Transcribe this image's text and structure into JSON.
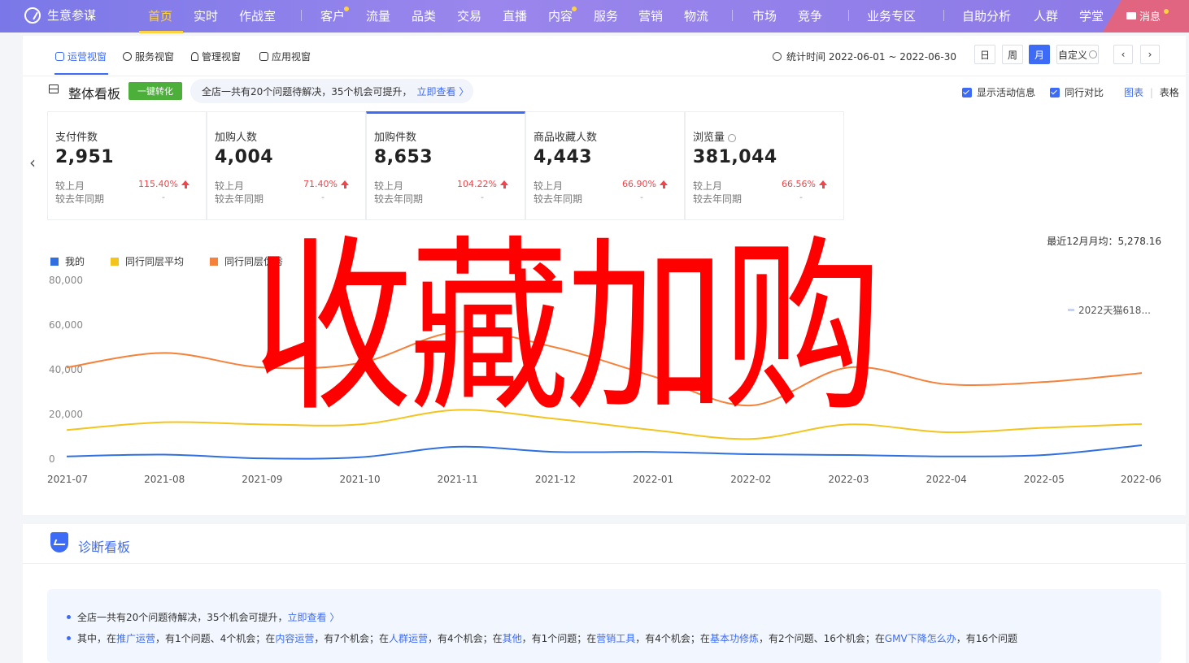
{
  "topnav": {
    "brand": "生意参谋",
    "items": [
      {
        "label": "首页",
        "active": true
      },
      {
        "label": "实时"
      },
      {
        "label": "作战室"
      },
      {
        "label": "客户",
        "dot": true
      },
      {
        "label": "流量"
      },
      {
        "label": "品类"
      },
      {
        "label": "交易"
      },
      {
        "label": "直播"
      },
      {
        "label": "内容",
        "dot": true
      },
      {
        "label": "服务"
      },
      {
        "label": "营销"
      },
      {
        "label": "物流"
      },
      {
        "label": "市场"
      },
      {
        "label": "竞争"
      },
      {
        "label": "业务专区"
      },
      {
        "label": "自助分析"
      },
      {
        "label": "人群"
      },
      {
        "label": "学堂"
      }
    ],
    "message": "消息",
    "accent": "#ffd23f"
  },
  "view_tabs": [
    {
      "label": "运营视窗",
      "icon": "shield-icon",
      "active": true
    },
    {
      "label": "服务视窗",
      "icon": "headset-icon"
    },
    {
      "label": "管理视窗",
      "icon": "bulb-icon"
    },
    {
      "label": "应用视窗",
      "icon": "home-icon"
    }
  ],
  "stat_time": "统计时间 2022-06-01 ~ 2022-06-30",
  "date_buttons": [
    "日",
    "周",
    "月",
    "自定义"
  ],
  "date_active": "月",
  "board": {
    "title": "整体看板",
    "convert_button": "一键转化",
    "issue_text": "全店一共有20个问题待解决，35个机会可提升，",
    "issue_link": "立即查看 〉",
    "show_activity": "显示活动信息",
    "peer_compare": "同行对比",
    "view_chart": "图表",
    "view_sep": "|",
    "view_table": "表格"
  },
  "kpis": [
    {
      "label": "支付件数",
      "value": "2,951",
      "mom_label": "较上月",
      "mom": "115.40%",
      "yoy_label": "较去年同期",
      "yoy": "-"
    },
    {
      "label": "加购人数",
      "value": "4,004",
      "mom_label": "较上月",
      "mom": "71.40%",
      "yoy_label": "较去年同期",
      "yoy": "-"
    },
    {
      "label": "加购件数",
      "value": "8,653",
      "mom_label": "较上月",
      "mom": "104.22%",
      "yoy_label": "较去年同期",
      "yoy": "-",
      "active": true
    },
    {
      "label": "商品收藏人数",
      "value": "4,443",
      "mom_label": "较上月",
      "mom": "66.90%",
      "yoy_label": "较去年同期",
      "yoy": "-"
    },
    {
      "label": "浏览量",
      "value": "381,044",
      "mom_label": "较上月",
      "mom": "66.56%",
      "yoy_label": "较去年同期",
      "yoy": "-"
    }
  ],
  "avg_note": "最近12月月均：5,278.16",
  "chart_data": {
    "type": "line",
    "categories": [
      "2021-07",
      "2021-08",
      "2021-09",
      "2021-10",
      "2021-11",
      "2021-12",
      "2022-01",
      "2022-02",
      "2022-03",
      "2022-04",
      "2022-05",
      "2022-06"
    ],
    "y_ticks": [
      "80,000",
      "60,000",
      "40,000",
      "20,000",
      "0"
    ],
    "ylim": [
      0,
      80000
    ],
    "series": [
      {
        "name": "我的",
        "color": "#2f6fe0",
        "values": [
          1200,
          2000,
          300,
          800,
          5500,
          3200,
          3200,
          2200,
          1800,
          1200,
          1800,
          6200
        ]
      },
      {
        "name": "同行同层平均",
        "color": "#f2c41c",
        "values": [
          13000,
          16500,
          15500,
          15500,
          22000,
          18000,
          13000,
          9000,
          15500,
          12000,
          14000,
          15700
        ]
      },
      {
        "name": "同行同层优秀",
        "color": "#f5813a",
        "values": [
          41000,
          47500,
          41000,
          43000,
          57000,
          50000,
          37000,
          24000,
          41000,
          33500,
          34500,
          38500
        ]
      }
    ],
    "annotation": "2022天猫618..."
  },
  "watermark": "收藏加购",
  "diagnose": {
    "title": "诊断看板",
    "line1_text": "全店一共有20个问题待解决，35个机会可提升，",
    "line1_link": "立即查看 〉",
    "line2": [
      {
        "t": "其中，在"
      },
      {
        "t": "推广运营",
        "link": true
      },
      {
        "t": "，有1个问题、4个机会；在"
      },
      {
        "t": "内容运营",
        "link": true
      },
      {
        "t": "，有7个机会；在"
      },
      {
        "t": "人群运营",
        "link": true
      },
      {
        "t": "，有4个机会；在"
      },
      {
        "t": "其他",
        "link": true
      },
      {
        "t": "，有1个问题；在"
      },
      {
        "t": "营销工具",
        "link": true
      },
      {
        "t": "，有4个机会；在"
      },
      {
        "t": "基本功修炼",
        "link": true
      },
      {
        "t": "，有2个问题、16个机会；在"
      },
      {
        "t": "GMV下降怎么办",
        "link": true
      },
      {
        "t": "，有16个问题"
      }
    ]
  }
}
